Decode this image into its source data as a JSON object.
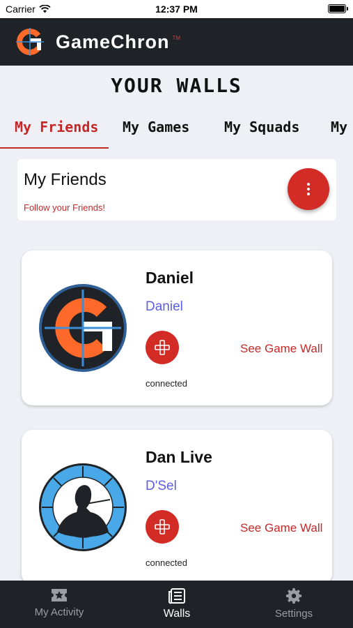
{
  "status_bar": {
    "carrier": "Carrier",
    "time": "12:37 PM"
  },
  "header": {
    "app_name": "GameChron",
    "trademark": "TM",
    "brand_color": "#d32b26",
    "logo_icon": "gamechron-logo-icon"
  },
  "page": {
    "title": "YOUR WALLS"
  },
  "tabs": [
    {
      "label": "My Friends",
      "active": true
    },
    {
      "label": "My Games",
      "active": false
    },
    {
      "label": "My Squads",
      "active": false
    },
    {
      "label": "My",
      "active": false
    }
  ],
  "section": {
    "title": "My Friends",
    "subtitle": "Follow your Friends!",
    "menu_icon": "more-vertical-icon"
  },
  "friends": [
    {
      "name": "Daniel",
      "handle": "Daniel",
      "link": "See Game Wall",
      "status": "connected",
      "game_icon": "gamepad-icon"
    },
    {
      "name": "Dan Live",
      "handle": "D'Sel",
      "link": "See Game Wall",
      "status": "connected",
      "game_icon": "gamepad-icon"
    }
  ],
  "bottom_nav": [
    {
      "label": "My Activity",
      "icon": "ticket-star-icon",
      "active": false
    },
    {
      "label": "Walls",
      "icon": "newspaper-icon",
      "active": true
    },
    {
      "label": "Settings",
      "icon": "gear-icon",
      "active": false
    }
  ]
}
